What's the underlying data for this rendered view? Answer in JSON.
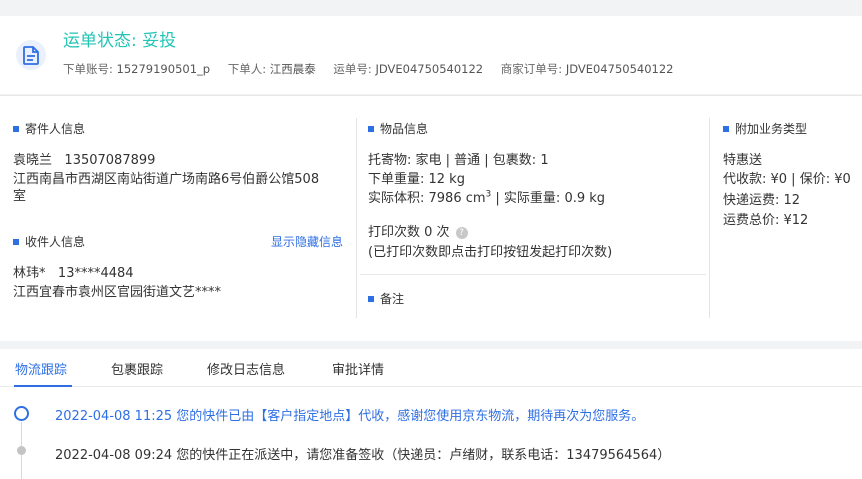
{
  "header": {
    "status_label": "运单状态: ",
    "status_value": "妥投",
    "meta": [
      {
        "label": "下单账号: ",
        "value": "15279190501_p"
      },
      {
        "label": "下单人: ",
        "value": "江西晨泰"
      },
      {
        "label": "运单号: ",
        "value": "JDVE04750540122"
      },
      {
        "label": "商家订单号: ",
        "value": "JDVE04750540122"
      }
    ],
    "icon": "document-icon"
  },
  "sender": {
    "title": "寄件人信息",
    "name": "袁晓兰",
    "phone": "13507087899",
    "address_line1": "江西南昌市西湖区南站街道广场南路6号伯爵公馆508",
    "address_line2": "室"
  },
  "receiver": {
    "title": "收件人信息",
    "show_hidden_link": "显示隐藏信息",
    "name": "林玮*",
    "phone": "13****4484",
    "address": "江西宜春市袁州区官园街道文艺****"
  },
  "goods": {
    "title": "物品信息",
    "line1": "托寄物:  家电 | 普通 |  包裹数:  1",
    "line2": "下单重量:  12 kg",
    "volume_label": "实际体积:  ",
    "volume_value": "7986 cm",
    "volume_sup": "3",
    "weight_part": " |  实际重量:  0.9 kg",
    "print_line": "打印次数   0 次",
    "print_hint": "(已打印次数即点击打印按钮发起打印次数)",
    "remark_title": "备注"
  },
  "extra": {
    "title": "附加业务类型",
    "line1": "特惠送",
    "line2": "代收款:  ¥0  |  保价:  ¥0",
    "line3": "快递运费:  12",
    "line4": "运费总价:  ¥12"
  },
  "tabs": [
    {
      "label": "物流跟踪"
    },
    {
      "label": "包裹跟踪"
    },
    {
      "label": "修改日志信息"
    },
    {
      "label": "审批详情"
    }
  ],
  "timeline": [
    {
      "text": "2022-04-08 11:25 您的快件已由【客户指定地点】代收，感谢您使用京东物流，期待再次为您服务。"
    },
    {
      "text": "2022-04-08 09:24 您的快件正在派送中，请您准备签收（快递员：卢绪财，联系电话：13479564564）"
    }
  ],
  "colors": {
    "accent": "#2f6fe4",
    "status": "#23c5b5",
    "background": "#f2f3f5"
  }
}
